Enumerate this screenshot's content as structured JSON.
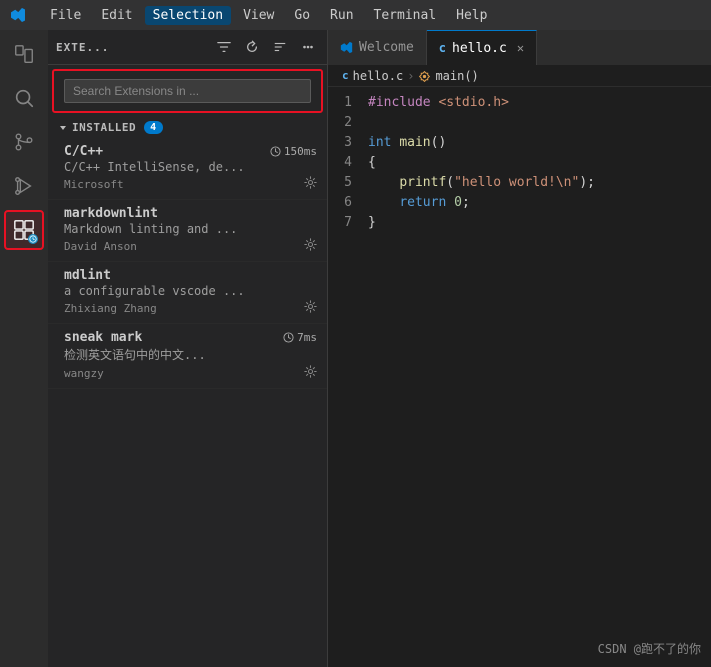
{
  "titlebar": {
    "menu_items": [
      "File",
      "Edit",
      "Selection",
      "View",
      "Go",
      "Run",
      "Terminal",
      "Help"
    ],
    "active_menu": "Selection"
  },
  "activity_bar": {
    "icons": [
      {
        "name": "explorer-icon",
        "symbol": "📄",
        "active": false
      },
      {
        "name": "search-icon",
        "symbol": "🔍",
        "active": false
      },
      {
        "name": "source-control-icon",
        "symbol": "⎇",
        "active": false
      },
      {
        "name": "run-debug-icon",
        "symbol": "▷",
        "active": false
      },
      {
        "name": "extensions-icon",
        "symbol": "⊞",
        "active": true
      }
    ]
  },
  "sidebar": {
    "title": "EXTE...",
    "search_placeholder": "Search Extensions in ...",
    "section_label": "INSTALLED",
    "installed_count": "4",
    "extensions": [
      {
        "name": "C/C++",
        "description": "C/C++ IntelliSense, de...",
        "author": "Microsoft",
        "timing": "150ms",
        "has_timing": true,
        "gear": true
      },
      {
        "name": "markdownlint",
        "description": "Markdown linting and ...",
        "author": "David Anson",
        "timing": "",
        "has_timing": false,
        "gear": true
      },
      {
        "name": "mdlint",
        "description": "a configurable vscode ...",
        "author": "Zhixiang Zhang",
        "timing": "",
        "has_timing": false,
        "gear": true
      },
      {
        "name": "sneak mark",
        "description": "检测英文语句中的中文...",
        "author": "wangzy",
        "timing": "7ms",
        "has_timing": true,
        "gear": true
      }
    ]
  },
  "tabs": [
    {
      "label": "Welcome",
      "icon": "vscode-icon",
      "active": false,
      "closable": false
    },
    {
      "label": "hello.c",
      "icon": "c-file-icon",
      "active": true,
      "closable": true
    }
  ],
  "breadcrumb": {
    "file": "hello.c",
    "symbol": "main()"
  },
  "code": {
    "lines": [
      {
        "number": "1",
        "content": "#include <stdio.h>",
        "type": "include"
      },
      {
        "number": "2",
        "content": "",
        "type": "empty"
      },
      {
        "number": "3",
        "content": "int main()",
        "type": "function"
      },
      {
        "number": "4",
        "content": "{",
        "type": "brace"
      },
      {
        "number": "5",
        "content": "    printf(\"hello world!\\n\");",
        "type": "call"
      },
      {
        "number": "6",
        "content": "    return 0;",
        "type": "return"
      },
      {
        "number": "7",
        "content": "}",
        "type": "brace"
      }
    ]
  },
  "watermark": {
    "text": "CSDN @跑不了的你"
  }
}
